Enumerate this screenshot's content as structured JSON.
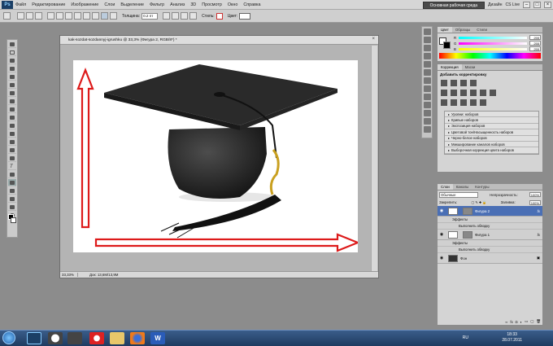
{
  "menubar": {
    "logo": "Ps",
    "items": [
      "Файл",
      "Редактирование",
      "Изображение",
      "Слои",
      "Выделение",
      "Фильтр",
      "Анализ",
      "3D",
      "Просмотр",
      "Окно",
      "Справка"
    ],
    "workspace_button": "Основная рабочая среда",
    "design_link": "Дизайн",
    "cslive": "CS Live"
  },
  "options_bar": {
    "thickness_label": "Толщина:",
    "thickness_value": "0.2 пт",
    "styles_label": "Стиль:",
    "color_label": "Цвет:",
    "color_value": "#ffffff"
  },
  "document": {
    "title": "kak-sozdat-sozdannyj-igrushku @ 33,3% (Фигура 2, RGB/8*) *",
    "zoom": "33,33%",
    "doc_size": "Док: 13,6М/13,9М"
  },
  "color_panel": {
    "tabs": [
      "Цвет",
      "Образцы",
      "Стили"
    ],
    "channels": [
      {
        "label": "R",
        "value": "255"
      },
      {
        "label": "G",
        "value": "255"
      },
      {
        "label": "B",
        "value": "255"
      }
    ]
  },
  "adjustments_panel": {
    "tabs": [
      "Коррекция",
      "Маски"
    ],
    "header": "Добавить корректировку",
    "presets": [
      "Уровни: наборов",
      "Кривые наборов",
      "Экспозиция наборов",
      "Цветовой тон/Насыщенность наборов",
      "Черно-белое наборов",
      "Микширование каналов наборов",
      "Выборочная коррекция цвета наборов"
    ]
  },
  "layers_panel": {
    "tabs": [
      "Слои",
      "Каналы",
      "Контуры"
    ],
    "blend_mode": "Обычные",
    "opacity_label": "Непрозрачность:",
    "opacity_value": "100%",
    "lock_label": "Закрепить:",
    "fill_label": "Заливка:",
    "fill_value": "100%",
    "layers": [
      {
        "name": "Фигура 2",
        "effects_label": "Эффекты",
        "stroke_label": "Выполнить обводку",
        "fx": "fx"
      },
      {
        "name": "Фигура 1",
        "effects_label": "Эффекты",
        "stroke_label": "Выполнить обводку",
        "fx": "fx"
      },
      {
        "name": "Фон"
      }
    ]
  },
  "taskbar": {
    "lang": "RU",
    "time": "18:33",
    "date": "28.07.2011"
  },
  "colors": {
    "arrow_red": "#dd1a1a",
    "selection_blue": "#4a6fb5"
  }
}
